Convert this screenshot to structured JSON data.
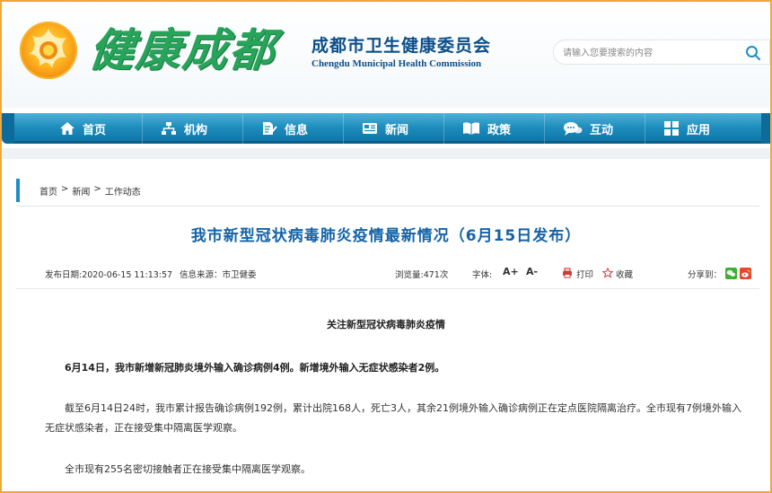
{
  "header": {
    "logo_text": "健康成都",
    "org_name_cn": "成都市卫生健康委员会",
    "org_name_en": "Chengdu Municipal Health Commission",
    "search_placeholder": "请输入您要搜索的内容"
  },
  "nav": {
    "items": [
      {
        "label": "首页",
        "icon": "home-icon"
      },
      {
        "label": "机构",
        "icon": "org-chart-icon"
      },
      {
        "label": "信息",
        "icon": "document-edit-icon"
      },
      {
        "label": "新闻",
        "icon": "newspaper-icon"
      },
      {
        "label": "政策",
        "icon": "book-icon"
      },
      {
        "label": "互动",
        "icon": "chat-icon"
      },
      {
        "label": "应用",
        "icon": "grid-icon"
      }
    ]
  },
  "breadcrumb": {
    "home": "首页",
    "sep1": ">",
    "news": "新闻",
    "sep2": ">",
    "current": "工作动态"
  },
  "article": {
    "title": "我市新型冠状病毒肺炎疫情最新情况（6月15日发布）",
    "publish_date": "发布日期:2020-06-15 11:13:57",
    "source": "信息来源：市卫健委",
    "views": "浏览量:471次",
    "font_label": "字体:",
    "font_increase": "A+",
    "font_decrease": "A-",
    "print_label": "打印",
    "favorite_label": "收藏",
    "share_label": "分享到：",
    "subheading": "关注新型冠状病毒肺炎疫情",
    "paragraph_1": "6月14日，我市新增新冠肺炎境外输入确诊病例4例。新增境外输入无症状感染者2例。",
    "paragraph_2": "截至6月14日24时，我市累计报告确诊病例192例，累计出院168人，死亡3人，其余21例境外输入确诊病例正在定点医院隔离治疗。全市现有7例境外输入无症状感染者，正在接受集中隔离医学观察。",
    "paragraph_3": "全市现有255名密切接触者正在接受集中隔离医学观察。"
  },
  "colors": {
    "accent_blue": "#1463a8",
    "nav_blue": "#1e8dbd",
    "logo_green": "#27a35a",
    "frame_orange": "#f0a83a",
    "print_red": "#d33a3a"
  }
}
